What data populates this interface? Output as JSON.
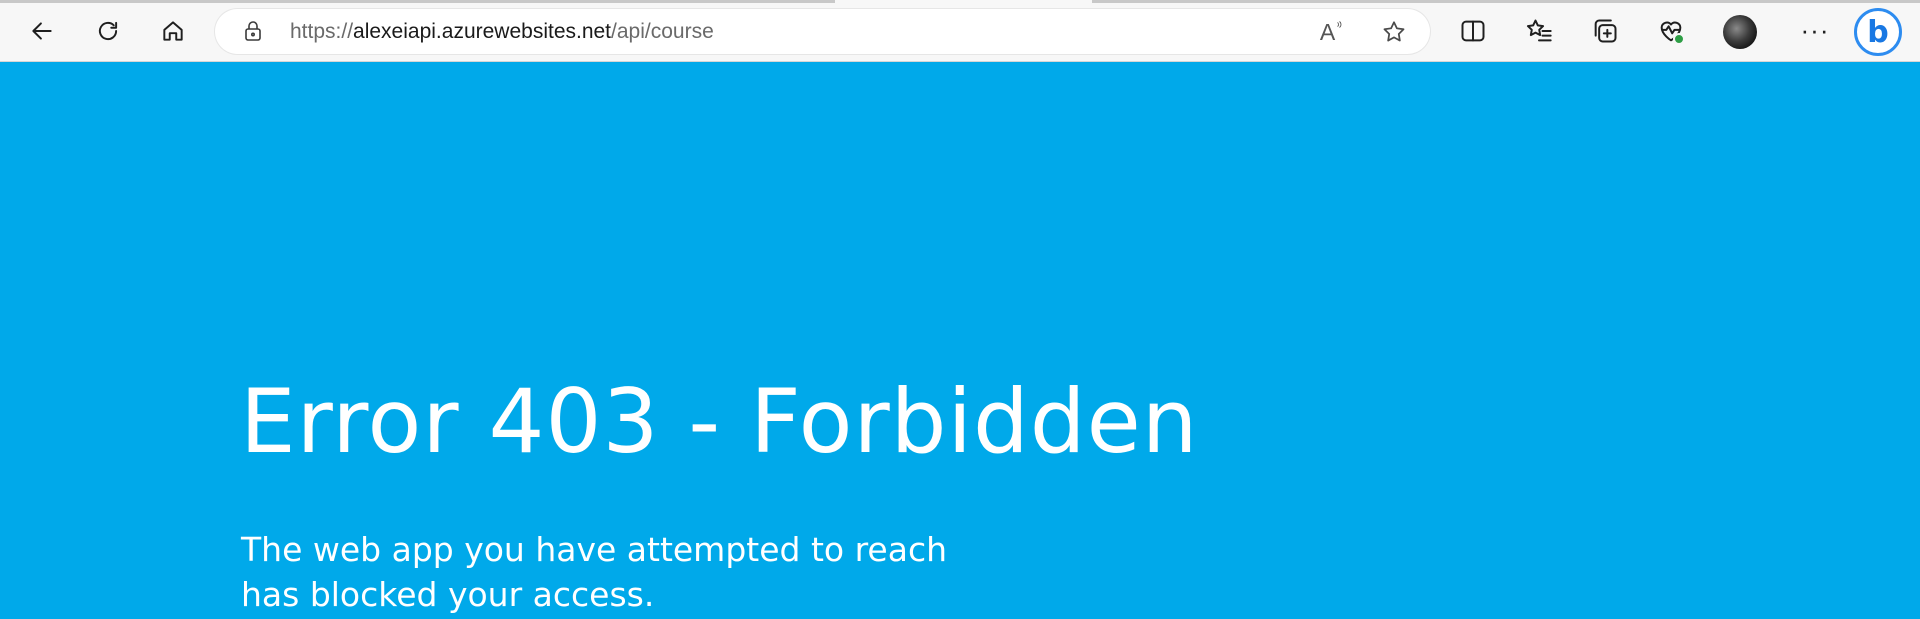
{
  "browser": {
    "address_bar": {
      "url_prefix": "https://",
      "url_host": "alexeiapi.azurewebsites.net",
      "url_path": "/api/course"
    },
    "read_aloud_glyph": "A",
    "more_glyph": "···",
    "copilot_glyph": "b",
    "icons": {
      "back": "arrow-left-icon",
      "refresh": "refresh-icon",
      "home": "home-icon",
      "lock": "lock-icon",
      "read_aloud": "read-aloud-icon",
      "favorite": "star-icon",
      "split_screen": "split-screen-icon",
      "favorites": "favorites-list-icon",
      "collections": "collections-icon",
      "browser_essentials": "heart-pulse-icon",
      "profile": "avatar",
      "more": "more-icon",
      "copilot": "copilot-icon"
    },
    "accent_color": "#1978e3"
  },
  "page": {
    "background_color": "#00a9ea",
    "error_title": "Error 403 - Forbidden",
    "error_message": "The web app you have attempted to reach has blocked your access."
  }
}
